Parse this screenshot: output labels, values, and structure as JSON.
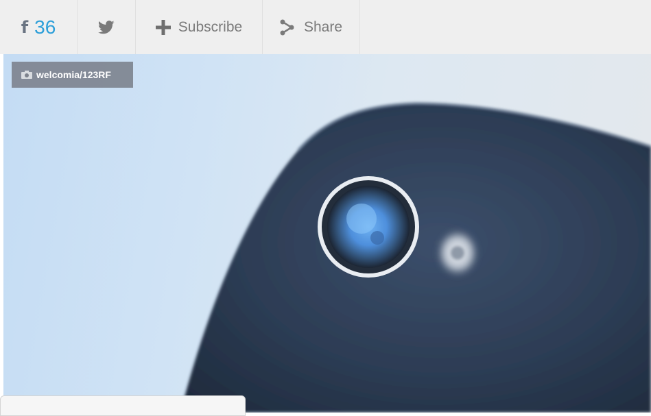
{
  "share_bar": {
    "facebook": {
      "glyph": "f",
      "count": "36",
      "icon": "facebook-icon"
    },
    "twitter": {
      "icon": "twitter-icon"
    },
    "subscribe": {
      "label": "Subscribe",
      "icon": "plus-icon"
    },
    "share": {
      "label": "Share",
      "icon": "share-icon"
    }
  },
  "hero_image": {
    "description_icon": "camera-icon",
    "credit": "welcomia/123RF"
  },
  "colors": {
    "bar_background": "#efefef",
    "facebook_count": "#2d9fd9",
    "icon_gray": "#7a7a7a",
    "credit_badge": "#7d828c"
  }
}
